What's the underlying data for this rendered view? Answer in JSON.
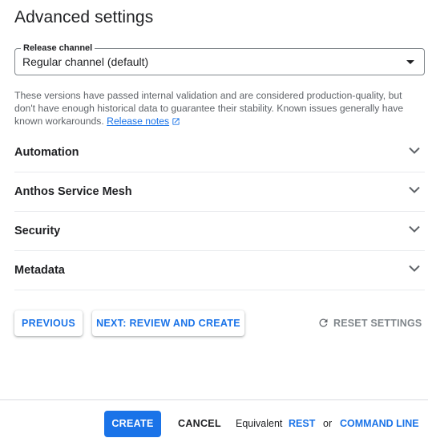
{
  "page": {
    "title": "Advanced settings"
  },
  "release_channel": {
    "label": "Release channel",
    "value": "Regular channel (default)"
  },
  "description": {
    "text": "These versions have passed internal validation and are considered production-quality, but don't have enough historical data to guarantee their stability. Known issues generally have known workarounds.",
    "link_label": "Release notes"
  },
  "sections": [
    {
      "label": "Automation"
    },
    {
      "label": "Anthos Service Mesh"
    },
    {
      "label": "Security"
    },
    {
      "label": "Metadata"
    }
  ],
  "actions": {
    "previous_label": "PREVIOUS",
    "next_label": "NEXT: REVIEW AND CREATE",
    "reset_label": "RESET SETTINGS"
  },
  "footer": {
    "create_label": "CREATE",
    "cancel_label": "CANCEL",
    "equivalent_label": "Equivalent",
    "rest_label": "REST",
    "or_label": "or",
    "cli_label": "COMMAND LINE"
  },
  "colors": {
    "accent": "#1a73e8",
    "text": "#202124",
    "muted": "#5f6368",
    "divider": "#e8eaed"
  },
  "icons": {
    "dropdown": "caret-down-icon",
    "external": "external-link-icon",
    "expand": "chevron-down-icon",
    "reset": "refresh-icon"
  }
}
